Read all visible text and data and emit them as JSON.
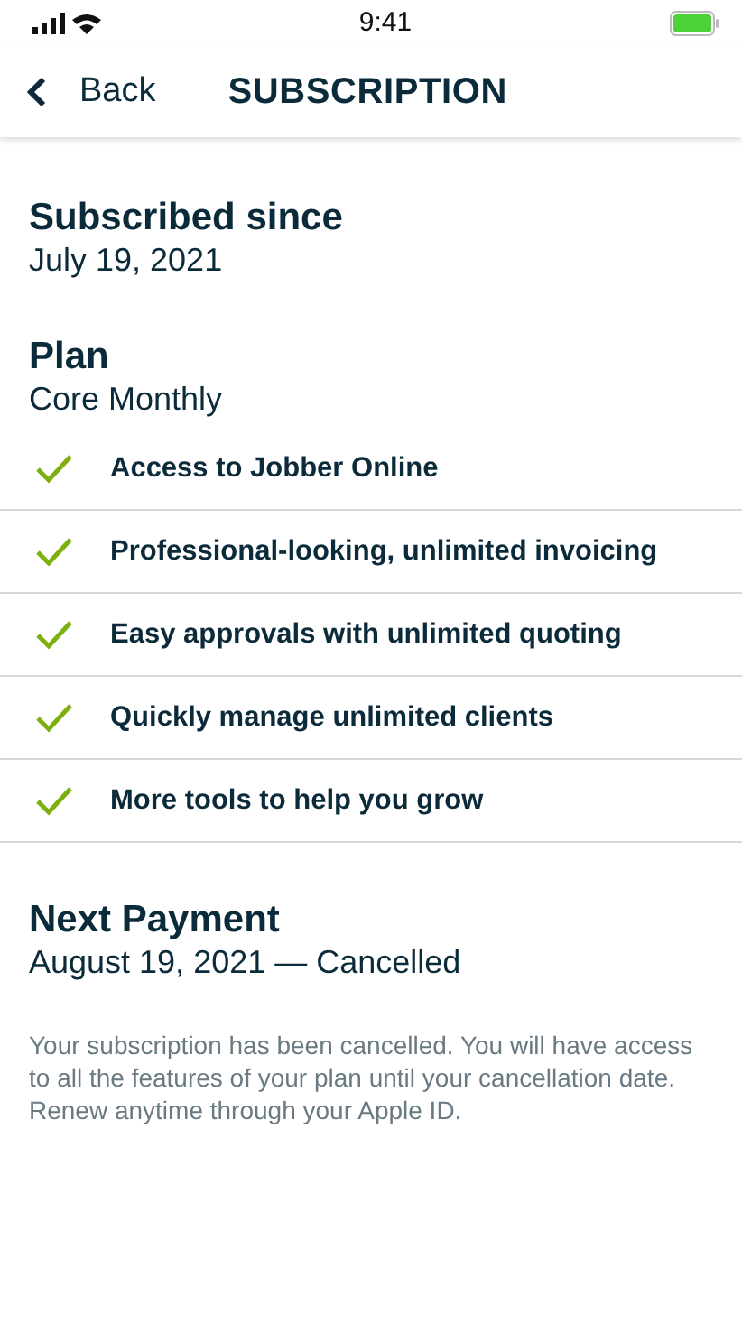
{
  "status_bar": {
    "time": "9:41"
  },
  "nav": {
    "back": "Back",
    "title": "SUBSCRIPTION"
  },
  "subscribed": {
    "label": "Subscribed since",
    "value": "July 19, 2021"
  },
  "plan": {
    "label": "Plan",
    "value": "Core Monthly",
    "features": [
      {
        "text": "Access to Jobber Online",
        "included": true
      },
      {
        "text": "Professional-looking, unlimited invoicing",
        "included": true
      },
      {
        "text": "Easy approvals with unlimited quoting",
        "included": true
      },
      {
        "text": "Quickly manage unlimited clients",
        "included": true
      },
      {
        "text": "More tools to help you grow",
        "included": true
      }
    ]
  },
  "next_payment": {
    "label": "Next Payment",
    "value": "August 19, 2021 — Cancelled"
  },
  "note": "Your subscription has been cancelled. You will have access to all the features of your plan until your cancellation date. Renew anytime through your Apple ID."
}
